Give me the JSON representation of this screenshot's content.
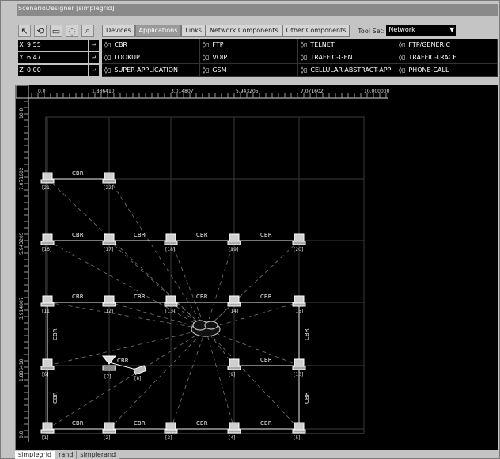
{
  "window": {
    "title": "ScenarioDesigner [simplegrid]"
  },
  "toolbar": {
    "tools": [
      {
        "name": "select-arrow-icon",
        "glyph": "↖"
      },
      {
        "name": "rotate-icon",
        "glyph": "⟲"
      },
      {
        "name": "rect-select-icon",
        "glyph": "▭"
      },
      {
        "name": "lasso-icon",
        "glyph": "◌"
      },
      {
        "name": "zoom-icon",
        "glyph": "⌕"
      }
    ]
  },
  "tabs": [
    {
      "label": "Devices",
      "active": false
    },
    {
      "label": "Applications",
      "active": true
    },
    {
      "label": "Links",
      "active": false
    },
    {
      "label": "Network Components",
      "active": false
    },
    {
      "label": "Other Components",
      "active": false
    }
  ],
  "toolset": {
    "label": "Tool Set:",
    "value": "Network"
  },
  "coords": [
    {
      "axis": "X",
      "value": "9.55"
    },
    {
      "axis": "Y",
      "value": "6.47"
    },
    {
      "axis": "Z",
      "value": "0.00"
    }
  ],
  "applications": [
    "CBR",
    "FTP",
    "TELNET",
    "FTP/GENERIC",
    "LOOKUP",
    "VOIP",
    "TRAFFIC-GEN",
    "TRAFFIC-TRACE",
    "SUPER-APPLICATION",
    "GSM",
    "CELLULAR-ABSTRACT-APP",
    "PHONE-CALL"
  ],
  "ruler": {
    "top": [
      "0.0",
      "1.886410",
      "3.014807",
      "5.943205",
      "7.071602",
      "10.000000"
    ],
    "left": [
      "10.0",
      "7.071602",
      "5.943205",
      "3.914807",
      "1.886410",
      "0.0"
    ]
  },
  "nodes": [
    {
      "id": "[21]",
      "col": 0,
      "row": 1
    },
    {
      "id": "[22]",
      "col": 1,
      "row": 1
    },
    {
      "id": "[16]",
      "col": 0,
      "row": 2
    },
    {
      "id": "[17]",
      "col": 1,
      "row": 2
    },
    {
      "id": "[18]",
      "col": 2,
      "row": 2
    },
    {
      "id": "[19]",
      "col": 3,
      "row": 2
    },
    {
      "id": "[20]",
      "col": 4,
      "row": 2
    },
    {
      "id": "[11]",
      "col": 0,
      "row": 3
    },
    {
      "id": "[12]",
      "col": 1,
      "row": 3
    },
    {
      "id": "[13]",
      "col": 2,
      "row": 3
    },
    {
      "id": "[14]",
      "col": 3,
      "row": 3
    },
    {
      "id": "[15]",
      "col": 4,
      "row": 3
    },
    {
      "id": "[6]",
      "col": 0,
      "row": 4
    },
    {
      "id": "[9]",
      "col": 3,
      "row": 4
    },
    {
      "id": "[10]",
      "col": 4,
      "row": 4
    },
    {
      "id": "[1]",
      "col": 0,
      "row": 5
    },
    {
      "id": "[2]",
      "col": 1,
      "row": 5
    },
    {
      "id": "[3]",
      "col": 2,
      "row": 5
    },
    {
      "id": "[4]",
      "col": 3,
      "row": 5
    },
    {
      "id": "[5]",
      "col": 4,
      "row": 5
    }
  ],
  "special_nodes": [
    {
      "id": "[7]",
      "kind": "antenna"
    },
    {
      "id": "[8]",
      "kind": "device"
    }
  ],
  "links_label": "CBR",
  "sheets": [
    {
      "label": "simplegrid",
      "active": true
    },
    {
      "label": "rand",
      "active": false
    },
    {
      "label": "simplerand",
      "active": false
    }
  ]
}
